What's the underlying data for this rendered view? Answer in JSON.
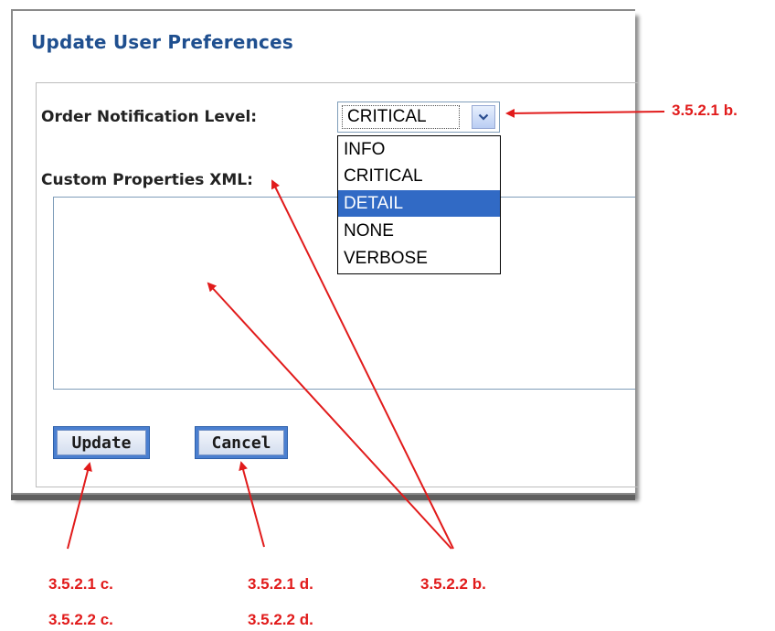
{
  "dialog": {
    "title": "Update User Preferences",
    "order_notification_label": "Order Notification Level:",
    "custom_properties_label": "Custom Properties XML:",
    "level_select": {
      "value": "CRITICAL",
      "options": [
        "INFO",
        "CRITICAL",
        "DETAIL",
        "NONE",
        "VERBOSE"
      ],
      "highlighted_option": "DETAIL"
    },
    "custom_properties_xml": "",
    "update_button": "Update",
    "cancel_button": "Cancel"
  },
  "annotations": {
    "select_ref": "3.5.2.1 b.",
    "update_ref_1": "3.5.2.1 c.",
    "update_ref_2": "3.5.2.2 c.",
    "cancel_ref_1": "3.5.2.1 d.",
    "cancel_ref_2": "3.5.2.2 d.",
    "xml_ref": "3.5.2.2 b.",
    "color": "#e11b1b"
  },
  "colors": {
    "title": "#1f4f8f",
    "selection": "#316ac5",
    "button_outer": "#4a7fd0"
  }
}
